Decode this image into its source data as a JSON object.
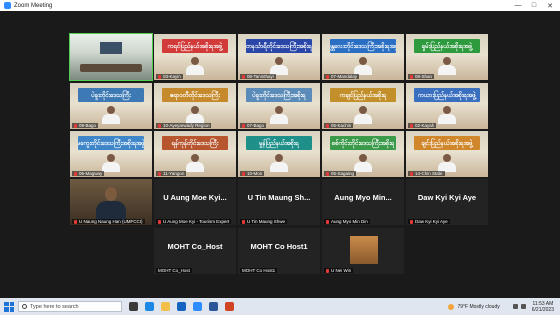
{
  "window": {
    "title": "Zoom Meeting",
    "controls": [
      "—",
      "□",
      "✕"
    ]
  },
  "tiles": [
    {
      "label": "",
      "banner": "",
      "kind": "room"
    },
    {
      "label": "03-Kayin",
      "banner": "ကရင်ပြည်နယ်အစိုးရအဖွဲ့",
      "kind": "video",
      "color": "#d23a3a"
    },
    {
      "label": "06-Taninthayi",
      "banner": "တနင်္သာရီတိုင်းဒေသကြီးအစိုးရ",
      "kind": "video",
      "color": "#2a46a8"
    },
    {
      "label": "07-Mandalay",
      "banner": "မန္တလေးတိုင်းဒေသကြီးအစိုးရအဖွဲ့",
      "kind": "video",
      "color": "#2a6fc4"
    },
    {
      "label": "08-Shan",
      "banner": "ရှမ်းပြည်နယ်အစိုးရအဖွဲ့",
      "kind": "video",
      "color": "#2e9a3e"
    },
    {
      "label": "09-Bago",
      "banner": "ပဲခူးတိုင်းဒေသကြီး",
      "kind": "video",
      "color": "#3d7ab5"
    },
    {
      "label": "10-Ayeyarwady Region",
      "banner": "ဧရာဝတီတိုင်းဒေသကြီး",
      "kind": "video",
      "color": "#c68a2c"
    },
    {
      "label": "07-Bago",
      "banner": "ပဲခူးတိုင်းဒေသကြီးအစိုးရ",
      "kind": "video",
      "color": "#5b8bb8"
    },
    {
      "label": "05-Kachin",
      "banner": "ကချင်ပြည်နယ်အစိုးရ",
      "kind": "video",
      "color": "#c28f2a"
    },
    {
      "label": "02-Kayah",
      "banner": "ကယားပြည်နယ်အစိုးရအဖွဲ့",
      "kind": "video",
      "color": "#3a6fc0"
    },
    {
      "label": "06-Magway",
      "banner": "မကွေးတိုင်းဒေသကြီးအစိုးရအဖွဲ့",
      "kind": "video",
      "color": "#3f86c9"
    },
    {
      "label": "11-Yangon",
      "banner": "ရန်ကုန်တိုင်းဒေသကြီး",
      "kind": "video",
      "color": "#b7552f"
    },
    {
      "label": "10-Mon",
      "banner": "မွန်ပြည်နယ်အစိုးရ",
      "kind": "video",
      "color": "#1f8f8a"
    },
    {
      "label": "05-Sagaing",
      "banner": "စစ်ကိုင်းတိုင်းဒေသကြီးအစိုးရ",
      "kind": "video",
      "color": "#3b9a4a"
    },
    {
      "label": "14-Chin State",
      "banner": "ချင်းပြည်နယ်အစိုးရအဖွဲ့",
      "kind": "video",
      "color": "#d0862a"
    },
    {
      "label": "U Naung Naung Han (UMFCCI)",
      "banner": "",
      "kind": "speaker"
    },
    {
      "label": "U Aung Moe Kyi - Tourism Expert",
      "name": "U Aung Moe Kyi...",
      "kind": "name"
    },
    {
      "label": "U Tin Maung Shwe",
      "name": "U Tin Maung Sh...",
      "kind": "name"
    },
    {
      "label": "Aung Myo Min Din",
      "name": "Aung Myo Min...",
      "kind": "name"
    },
    {
      "label": "Daw Kyi Kyi Aye",
      "name": "Daw Kyi Kyi Aye",
      "kind": "name"
    },
    {
      "label": "MOHT Co_Host",
      "name": "MOHT Co_Host",
      "kind": "name"
    },
    {
      "label": "MOHT Co Host1",
      "name": "MOHT Co Host1",
      "kind": "name"
    },
    {
      "label": "U Nei Win",
      "name": "",
      "kind": "photo"
    }
  ],
  "taskbar": {
    "search_placeholder": "Type here to search",
    "weather_temp": "79°F",
    "weather_text": "Mostly cloudy",
    "time": "11:53 AM",
    "date": "6/21/2023"
  }
}
